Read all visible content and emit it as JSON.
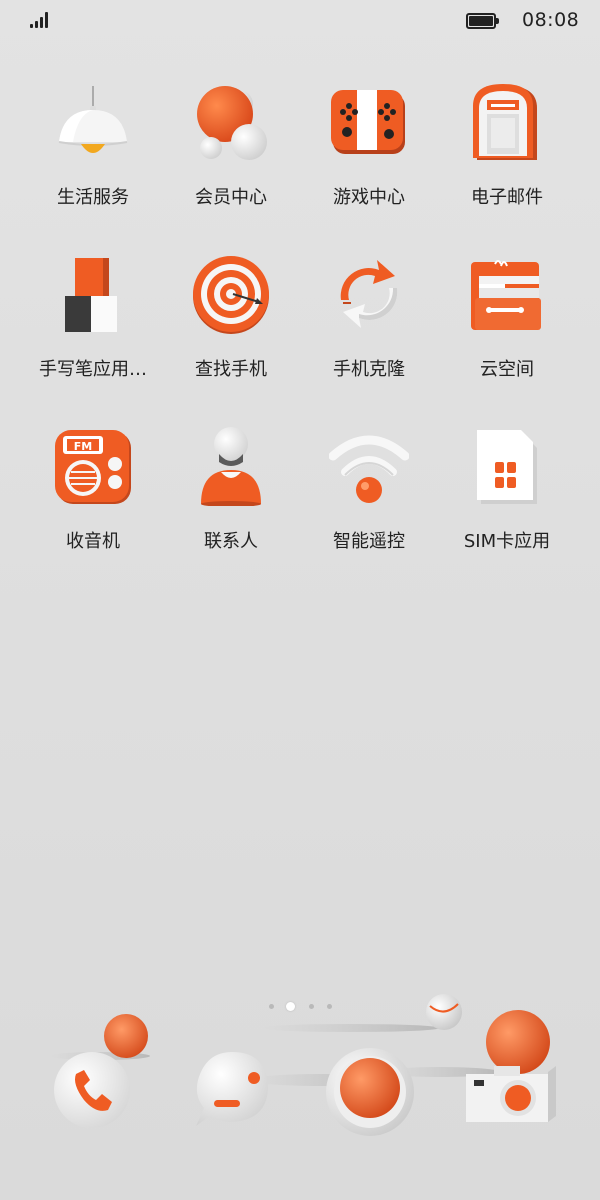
{
  "status": {
    "time": "08:08"
  },
  "apps": [
    {
      "label": "生活服务",
      "icon": "lamp-icon"
    },
    {
      "label": "会员中心",
      "icon": "member-balls-icon"
    },
    {
      "label": "游戏中心",
      "icon": "game-controller-icon"
    },
    {
      "label": "电子邮件",
      "icon": "mailbox-icon"
    },
    {
      "label": "手写笔应用…",
      "icon": "stylus-blocks-icon"
    },
    {
      "label": "查找手机",
      "icon": "target-icon"
    },
    {
      "label": "手机克隆",
      "icon": "clone-arrows-icon"
    },
    {
      "label": "云空间",
      "icon": "cloud-folder-icon"
    },
    {
      "label": "收音机",
      "icon": "radio-icon"
    },
    {
      "label": "联系人",
      "icon": "contact-person-icon"
    },
    {
      "label": "智能遥控",
      "icon": "remote-wifi-icon"
    },
    {
      "label": "SIM卡应用",
      "icon": "sim-card-icon"
    }
  ],
  "pager": {
    "total": 4,
    "active": 1
  },
  "dock": [
    {
      "icon": "phone-icon"
    },
    {
      "icon": "messages-icon"
    },
    {
      "icon": "browser-icon"
    },
    {
      "icon": "camera-icon"
    }
  ],
  "colors": {
    "accent": "#ee5d24",
    "accent_dark": "#c9461a",
    "light": "#f4f4f4"
  }
}
